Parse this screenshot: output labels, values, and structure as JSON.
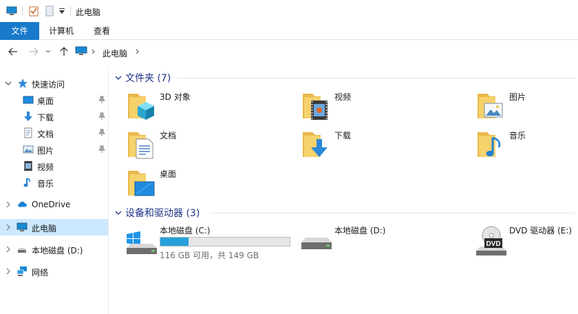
{
  "window": {
    "title": "此电脑"
  },
  "ribbon": {
    "tabs": [
      "文件",
      "计算机",
      "查看"
    ]
  },
  "address": {
    "crumbs": [
      "此电脑"
    ]
  },
  "nav": {
    "quick_access": "快速访问",
    "pinned": [
      {
        "label": "桌面",
        "icon": "desktop-icon"
      },
      {
        "label": "下载",
        "icon": "download-icon"
      },
      {
        "label": "文档",
        "icon": "document-icon"
      },
      {
        "label": "图片",
        "icon": "picture-icon"
      }
    ],
    "unpinned": [
      {
        "label": "视频",
        "icon": "video-icon"
      },
      {
        "label": "音乐",
        "icon": "music-icon"
      }
    ],
    "onedrive": "OneDrive",
    "this_pc": "此电脑",
    "local_d": "本地磁盘 (D:)",
    "network": "网络"
  },
  "content": {
    "folders_title": "文件夹 (7)",
    "folders": [
      "3D 对象",
      "视频",
      "图片",
      "文档",
      "下载",
      "音乐",
      "桌面"
    ],
    "devices_title": "设备和驱动器 (3)",
    "drives": [
      {
        "name": "本地磁盘 (C:)",
        "free_text": "116 GB 可用，共 149 GB",
        "used_fraction": 0.22
      },
      {
        "name": "本地磁盘 (D:)"
      },
      {
        "name": "DVD 驱动器 (E:)",
        "badge": "DVD"
      }
    ]
  },
  "colors": {
    "accent": "#1979ca",
    "selected": "#cce8ff",
    "section_title": "#1e3287",
    "usage_bar": "#26a0da",
    "folder": "#f6d26b"
  }
}
